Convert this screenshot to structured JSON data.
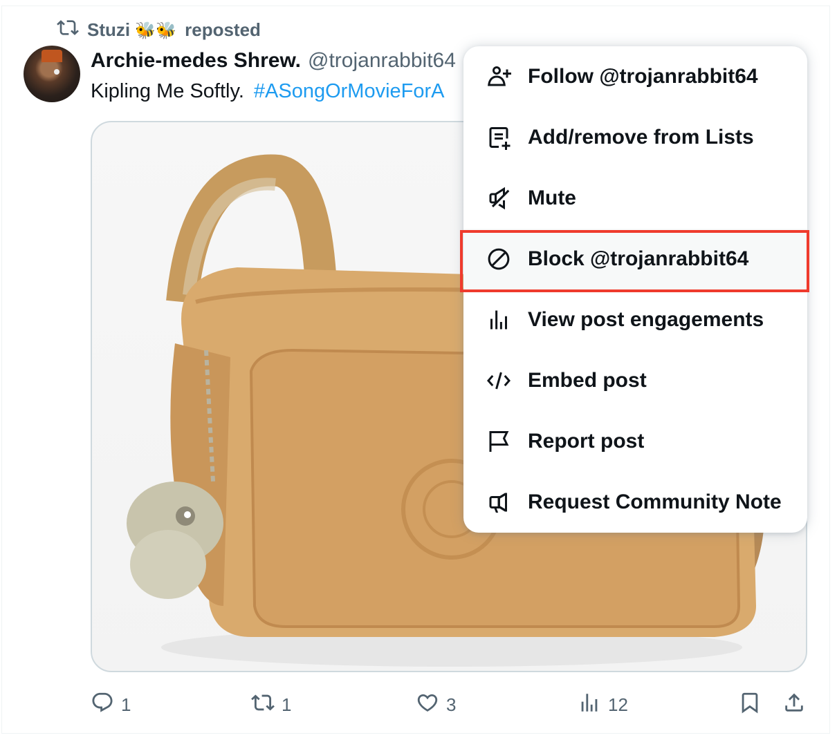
{
  "repost": {
    "icon": "repost-icon",
    "name": "Stuzi",
    "emoji": "🐝🐝",
    "label": "reposted"
  },
  "tweet": {
    "author_name": "Archie-medes Shrew.",
    "author_handle": "@trojanrabbit64",
    "text": "Kipling Me Softly.",
    "hashtag": "#ASongOrMovieForA",
    "media_alt": "tan crossbody bag with furry keychain"
  },
  "actions": {
    "replies": "1",
    "reposts": "1",
    "likes": "3",
    "views": "12"
  },
  "menu": {
    "items": [
      {
        "icon": "follow-user-icon",
        "label": "Follow @trojanrabbit64"
      },
      {
        "icon": "list-add-icon",
        "label": "Add/remove from Lists"
      },
      {
        "icon": "mute-speaker-icon",
        "label": "Mute"
      },
      {
        "icon": "block-icon",
        "label": "Block @trojanrabbit64"
      },
      {
        "icon": "engagements-chart-icon",
        "label": "View post engagements"
      },
      {
        "icon": "code-embed-icon",
        "label": "Embed post"
      },
      {
        "icon": "flag-icon",
        "label": "Report post"
      },
      {
        "icon": "megaphone-icon",
        "label": "Request Community Note"
      }
    ],
    "highlighted_index": 3
  },
  "colors": {
    "accent": "#1d9bf0",
    "muted_text": "#536471",
    "highlight_border": "#ef3b2d"
  }
}
